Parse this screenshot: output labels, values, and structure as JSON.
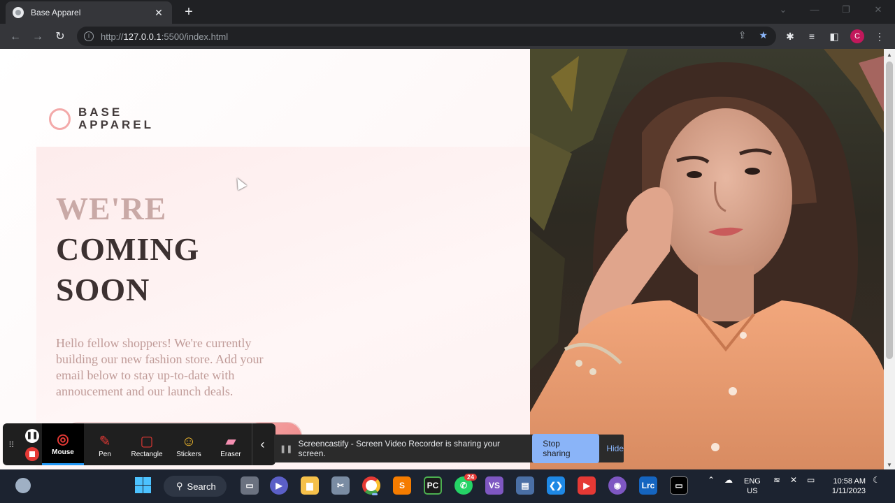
{
  "browser": {
    "tab_title": "Base Apparel",
    "url_prefix": "http://",
    "url_host": "127.0.0.1",
    "url_rest": ":5500/index.html",
    "profile_initial": "C"
  },
  "page": {
    "logo_line1": "BASE",
    "logo_line2": "APPAREL",
    "title_light": "WE'RE",
    "title_dark1": "COMING",
    "title_dark2": "SOON",
    "body_text": "Hello fellow shoppers! We're currently building our new fashion store. Add your email below to stay up-to-date with annoucement and our launch deals."
  },
  "screencastify": {
    "tools": [
      {
        "label": "Mouse",
        "icon": "mouse-icon"
      },
      {
        "label": "Pen",
        "icon": "pen-icon"
      },
      {
        "label": "Rectangle",
        "icon": "rectangle-icon"
      },
      {
        "label": "Stickers",
        "icon": "sticker-icon"
      },
      {
        "label": "Eraser",
        "icon": "eraser-icon"
      }
    ],
    "active_tool": "Mouse",
    "share_message": "Screencastify - Screen Video Recorder is sharing your screen.",
    "stop_label": "Stop sharing",
    "hide_label": "Hide"
  },
  "taskbar": {
    "search_label": "Search",
    "whatsapp_badge": "24",
    "lang_line1": "ENG",
    "lang_line2": "US",
    "time": "10:58 AM",
    "date": "1/11/2023",
    "lr_label": "Lrc"
  },
  "colors": {
    "accent_pink": "#f3a9a9",
    "title_light": "#c9a9a6",
    "title_dark": "#3c3131",
    "text_muted": "#c09b98"
  }
}
